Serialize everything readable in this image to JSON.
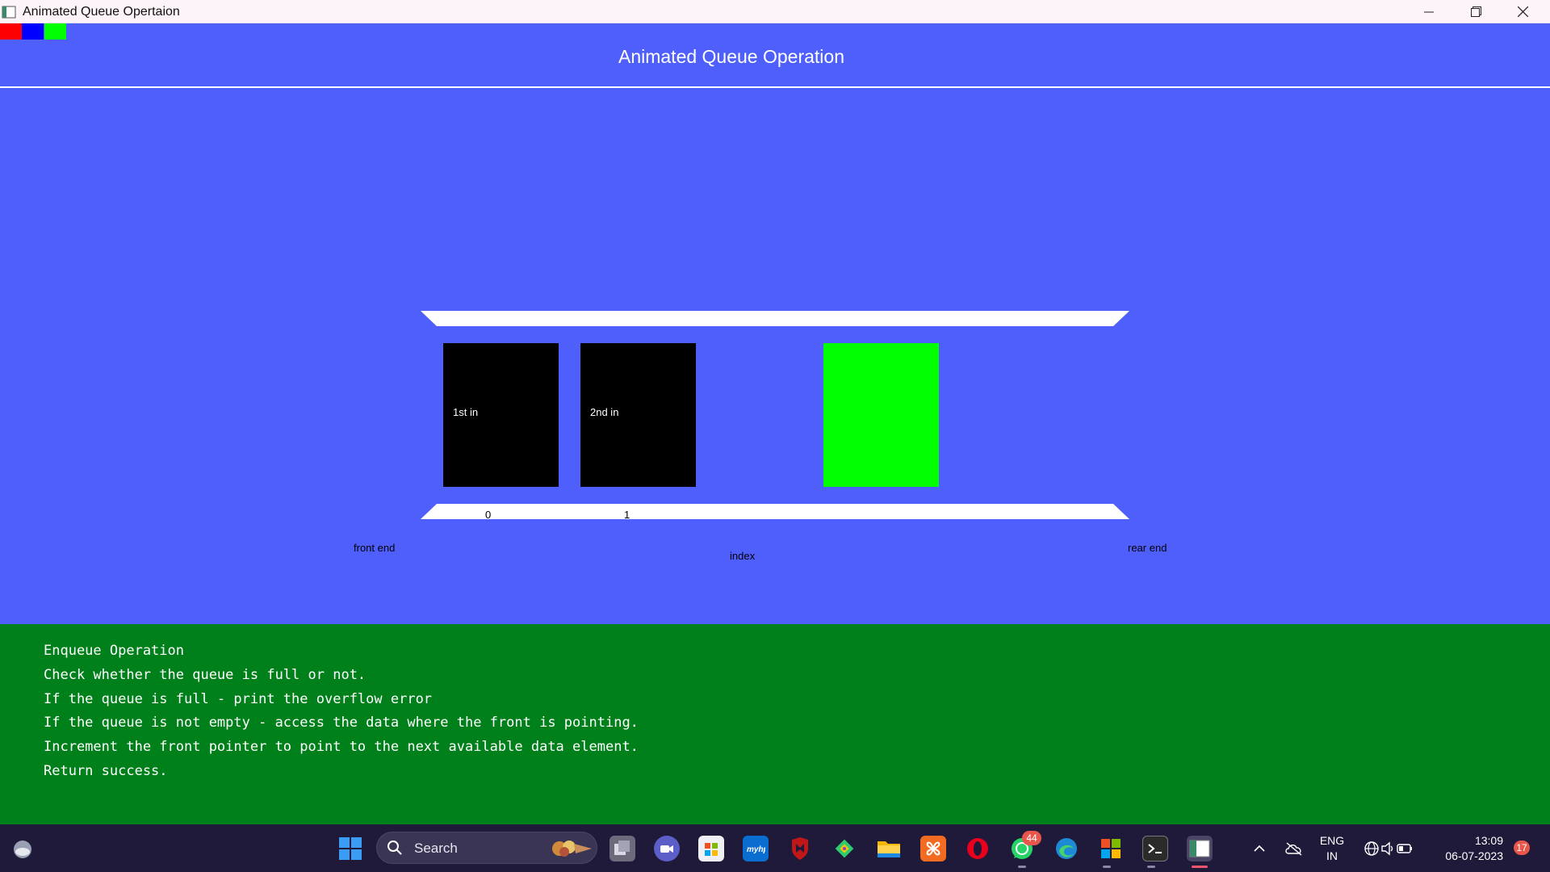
{
  "window": {
    "title": "Animated Queue Opertaion",
    "minimize_icon": "minimize-icon",
    "maximize_icon": "restore-icon",
    "close_icon": "close-icon"
  },
  "canvas": {
    "background_color": "#4f5ffc",
    "color_swatches": [
      "#ff0000",
      "#0000ff",
      "#00ff00"
    ],
    "heading": "Animated Queue Operation",
    "queue": {
      "slots": [
        {
          "label": "1st in",
          "color": "#000000",
          "index": "0"
        },
        {
          "label": "2nd in",
          "color": "#000000",
          "index": "1"
        },
        {
          "label": "",
          "color": "#00ff00",
          "index": ""
        }
      ],
      "front_label": "front end",
      "rear_label": "rear end",
      "index_label": "index"
    }
  },
  "info": {
    "background_color": "#00801a",
    "lines": [
      "Enqueue Operation",
      "Check whether the queue is full or not.",
      "If the queue is full - print the overflow error",
      "If the queue is not empty - access the data where the front is pointing.",
      "Increment the front pointer to point to the next available data element.",
      "Return success."
    ]
  },
  "taskbar": {
    "search_placeholder": "Search",
    "whatsapp_badge": "44",
    "language": "ENG",
    "region": "IN",
    "time": "13:09",
    "date": "06-07-2023",
    "notification_count": "17"
  }
}
